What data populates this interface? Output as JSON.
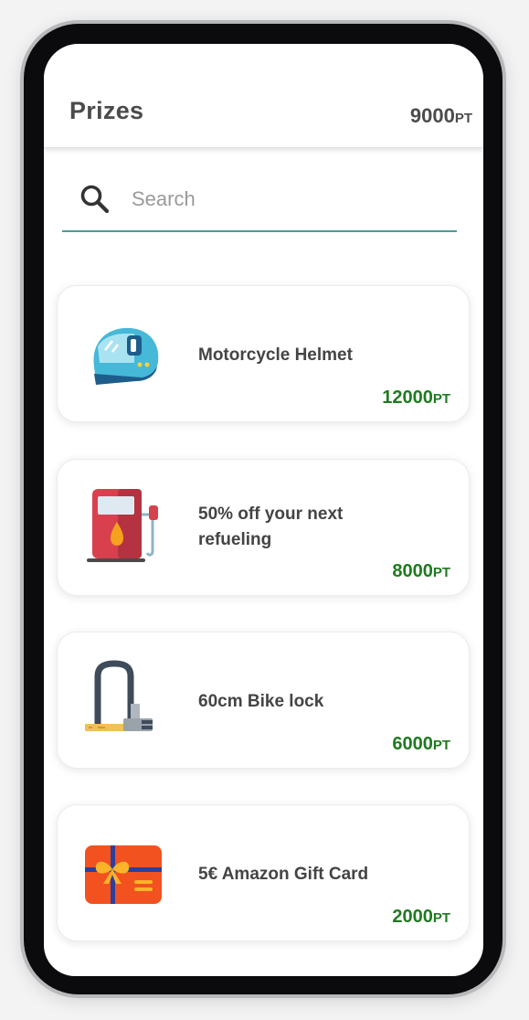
{
  "header": {
    "title": "Prizes",
    "balance_value": "9000",
    "balance_unit": "PT"
  },
  "search": {
    "placeholder": "Search",
    "value": ""
  },
  "prizes": [
    {
      "name": "Motorcycle Helmet",
      "price": "12000",
      "unit": "PT",
      "icon": "helmet-icon"
    },
    {
      "name": "50% off your next refueling",
      "price": "8000",
      "unit": "PT",
      "icon": "fuel-pump-icon"
    },
    {
      "name": "60cm Bike lock",
      "price": "6000",
      "unit": "PT",
      "icon": "bike-lock-icon"
    },
    {
      "name": "5€ Amazon Gift Card",
      "price": "2000",
      "unit": "PT",
      "icon": "gift-card-icon"
    }
  ],
  "colors": {
    "accent": "#4a9c92",
    "price": "#1f7a1f",
    "text": "#4b4b4b"
  }
}
